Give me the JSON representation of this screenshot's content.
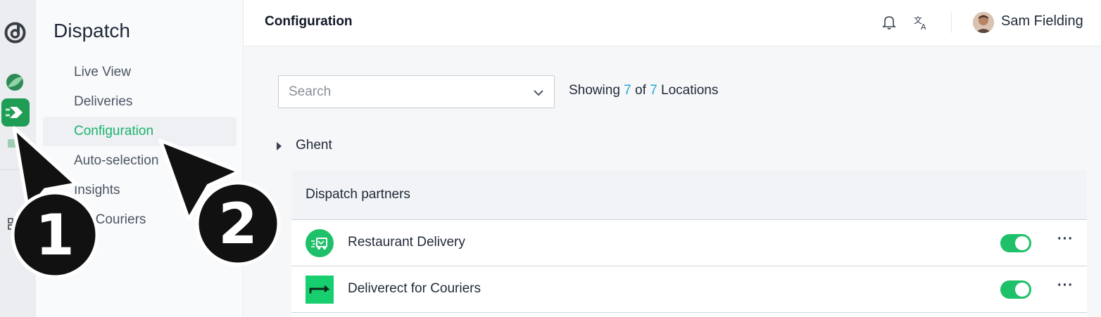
{
  "rail": {
    "icons": [
      "dispatch-logo-icon",
      "app-leaf-icon",
      "dispatch-app-icon",
      "app-box-icon",
      "grid-icon"
    ],
    "accent": "#1bb36b"
  },
  "sidebar": {
    "title": "Dispatch",
    "items": [
      {
        "label": "Live View"
      },
      {
        "label": "Deliveries"
      },
      {
        "label": "Configuration",
        "active": true
      },
      {
        "label": "Auto-selection"
      },
      {
        "label": "Insights"
      },
      {
        "label": "My Couriers"
      }
    ]
  },
  "header": {
    "title": "Configuration",
    "user_name": "Sam Fielding"
  },
  "main": {
    "search": {
      "placeholder": "Search"
    },
    "showing": {
      "prefix": "Showing",
      "shown": "7",
      "of": "of",
      "total": "7",
      "suffix": "Locations"
    },
    "group": {
      "name": "Ghent"
    },
    "section": {
      "title": "Dispatch partners",
      "partners": [
        {
          "name": "Restaurant Delivery",
          "enabled": true,
          "more": "···"
        },
        {
          "name": "Deliverect for Couriers",
          "enabled": true,
          "more": "···"
        }
      ]
    }
  },
  "overlay": {
    "markers": [
      {
        "label": "1"
      },
      {
        "label": "2"
      }
    ]
  },
  "colors": {
    "accent": "#1bb36b",
    "toggle_on": "#1fc06a",
    "link_number": "#2aa5d6"
  }
}
